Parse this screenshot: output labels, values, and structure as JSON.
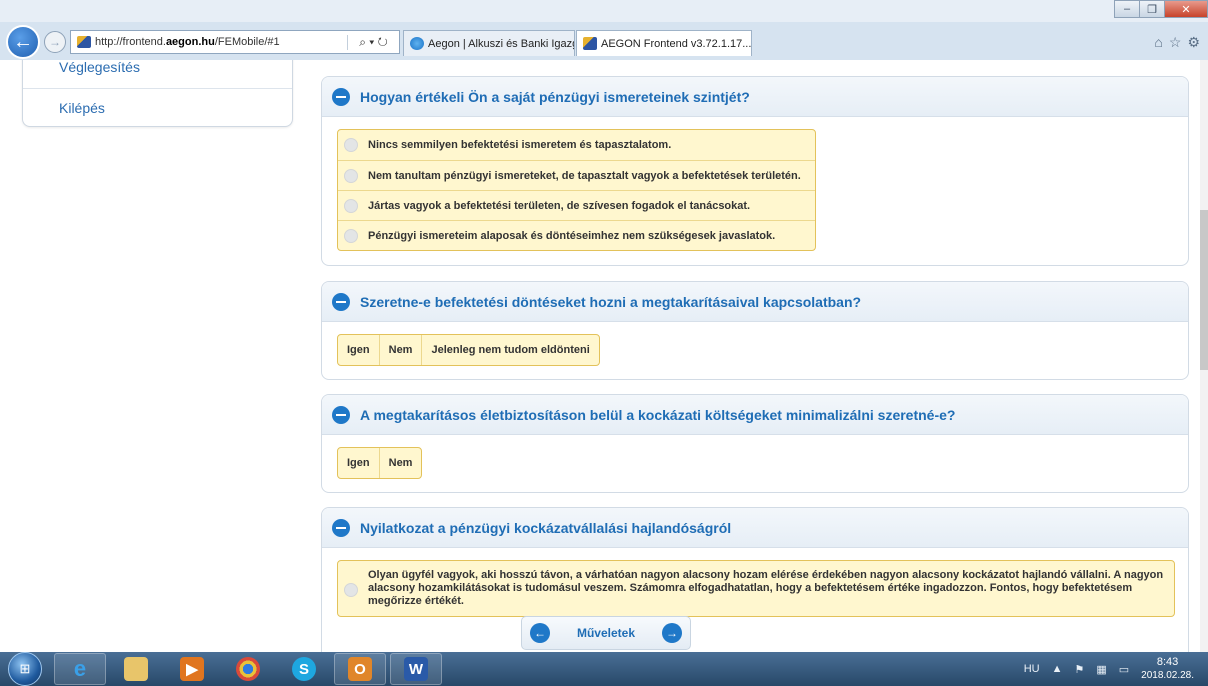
{
  "browser": {
    "url_prefix": "http://frontend.",
    "url_domain": "aegon.hu",
    "url_path": "/FEMobile/#1",
    "search_glyph": "⌕ ▾ ↻",
    "tabs": [
      {
        "label": "Aegon | Alkuszi és Banki Igazg..."
      },
      {
        "label": "AEGON Frontend v3.72.1.17...",
        "close": "×"
      }
    ]
  },
  "sidebar": {
    "items": [
      {
        "label": "Véglegesítés"
      },
      {
        "label": "Kilépés"
      }
    ]
  },
  "questions": [
    {
      "title": "Hogyan értékeli Ön a saját pénzügyi ismereteinek szintjét?",
      "options": [
        "Nincs semmilyen befektetési ismeretem és tapasztalatom.",
        "Nem tanultam pénzügyi ismereteket, de tapasztalt vagyok a befektetések területén.",
        "Jártas vagyok a befektetési területen, de szívesen fogadok el tanácsokat.",
        "Pénzügyi ismereteim alaposak és döntéseimhez nem szükségesek javaslatok."
      ]
    },
    {
      "title": "Szeretne-e befektetési döntéseket hozni a megtakarításaival kapcsolatban?",
      "options": [
        "Igen",
        "Nem",
        "Jelenleg nem tudom eldönteni"
      ]
    },
    {
      "title": "A megtakarításos életbiztosításon belül a kockázati költségeket minimalizálni szeretné-e?",
      "options": [
        "Igen",
        "Nem"
      ]
    },
    {
      "title": "Nyilatkozat a pénzügyi kockázatvállalási hajlandóságról",
      "options": [
        "Olyan ügyfél vagyok, aki hosszú távon, a várhatóan nagyon alacsony hozam elérése érdekében nagyon alacsony kockázatot hajlandó vállalni. A nagyon alacsony hozamkilátásokat is tudomásul veszem. Számomra elfogadhatatlan, hogy a befektetésem értéke ingadozzon. Fontos, hogy befektetésem megőrizze értékét."
      ]
    }
  ],
  "bottom_nav": {
    "label": "Műveletek"
  },
  "taskbar": {
    "lang": "HU",
    "time": "8:43",
    "date": "2018.02.28."
  }
}
